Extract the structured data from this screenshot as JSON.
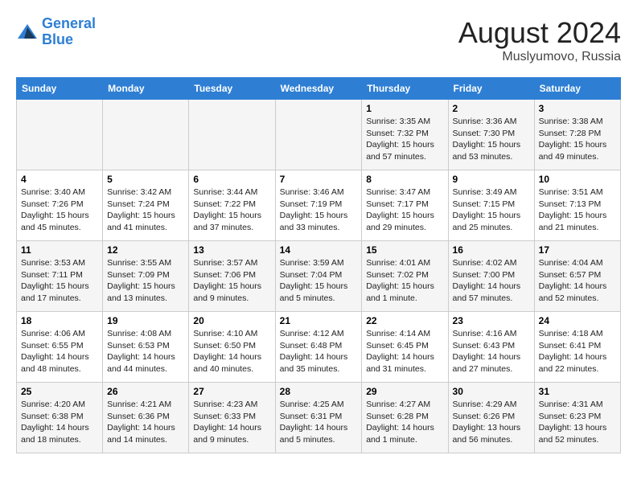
{
  "header": {
    "logo_line1": "General",
    "logo_line2": "Blue",
    "month": "August 2024",
    "location": "Muslyumovo, Russia"
  },
  "weekdays": [
    "Sunday",
    "Monday",
    "Tuesday",
    "Wednesday",
    "Thursday",
    "Friday",
    "Saturday"
  ],
  "weeks": [
    [
      {
        "day": "",
        "info": ""
      },
      {
        "day": "",
        "info": ""
      },
      {
        "day": "",
        "info": ""
      },
      {
        "day": "",
        "info": ""
      },
      {
        "day": "1",
        "info": "Sunrise: 3:35 AM\nSunset: 7:32 PM\nDaylight: 15 hours\nand 57 minutes."
      },
      {
        "day": "2",
        "info": "Sunrise: 3:36 AM\nSunset: 7:30 PM\nDaylight: 15 hours\nand 53 minutes."
      },
      {
        "day": "3",
        "info": "Sunrise: 3:38 AM\nSunset: 7:28 PM\nDaylight: 15 hours\nand 49 minutes."
      }
    ],
    [
      {
        "day": "4",
        "info": "Sunrise: 3:40 AM\nSunset: 7:26 PM\nDaylight: 15 hours\nand 45 minutes."
      },
      {
        "day": "5",
        "info": "Sunrise: 3:42 AM\nSunset: 7:24 PM\nDaylight: 15 hours\nand 41 minutes."
      },
      {
        "day": "6",
        "info": "Sunrise: 3:44 AM\nSunset: 7:22 PM\nDaylight: 15 hours\nand 37 minutes."
      },
      {
        "day": "7",
        "info": "Sunrise: 3:46 AM\nSunset: 7:19 PM\nDaylight: 15 hours\nand 33 minutes."
      },
      {
        "day": "8",
        "info": "Sunrise: 3:47 AM\nSunset: 7:17 PM\nDaylight: 15 hours\nand 29 minutes."
      },
      {
        "day": "9",
        "info": "Sunrise: 3:49 AM\nSunset: 7:15 PM\nDaylight: 15 hours\nand 25 minutes."
      },
      {
        "day": "10",
        "info": "Sunrise: 3:51 AM\nSunset: 7:13 PM\nDaylight: 15 hours\nand 21 minutes."
      }
    ],
    [
      {
        "day": "11",
        "info": "Sunrise: 3:53 AM\nSunset: 7:11 PM\nDaylight: 15 hours\nand 17 minutes."
      },
      {
        "day": "12",
        "info": "Sunrise: 3:55 AM\nSunset: 7:09 PM\nDaylight: 15 hours\nand 13 minutes."
      },
      {
        "day": "13",
        "info": "Sunrise: 3:57 AM\nSunset: 7:06 PM\nDaylight: 15 hours\nand 9 minutes."
      },
      {
        "day": "14",
        "info": "Sunrise: 3:59 AM\nSunset: 7:04 PM\nDaylight: 15 hours\nand 5 minutes."
      },
      {
        "day": "15",
        "info": "Sunrise: 4:01 AM\nSunset: 7:02 PM\nDaylight: 15 hours\nand 1 minute."
      },
      {
        "day": "16",
        "info": "Sunrise: 4:02 AM\nSunset: 7:00 PM\nDaylight: 14 hours\nand 57 minutes."
      },
      {
        "day": "17",
        "info": "Sunrise: 4:04 AM\nSunset: 6:57 PM\nDaylight: 14 hours\nand 52 minutes."
      }
    ],
    [
      {
        "day": "18",
        "info": "Sunrise: 4:06 AM\nSunset: 6:55 PM\nDaylight: 14 hours\nand 48 minutes."
      },
      {
        "day": "19",
        "info": "Sunrise: 4:08 AM\nSunset: 6:53 PM\nDaylight: 14 hours\nand 44 minutes."
      },
      {
        "day": "20",
        "info": "Sunrise: 4:10 AM\nSunset: 6:50 PM\nDaylight: 14 hours\nand 40 minutes."
      },
      {
        "day": "21",
        "info": "Sunrise: 4:12 AM\nSunset: 6:48 PM\nDaylight: 14 hours\nand 35 minutes."
      },
      {
        "day": "22",
        "info": "Sunrise: 4:14 AM\nSunset: 6:45 PM\nDaylight: 14 hours\nand 31 minutes."
      },
      {
        "day": "23",
        "info": "Sunrise: 4:16 AM\nSunset: 6:43 PM\nDaylight: 14 hours\nand 27 minutes."
      },
      {
        "day": "24",
        "info": "Sunrise: 4:18 AM\nSunset: 6:41 PM\nDaylight: 14 hours\nand 22 minutes."
      }
    ],
    [
      {
        "day": "25",
        "info": "Sunrise: 4:20 AM\nSunset: 6:38 PM\nDaylight: 14 hours\nand 18 minutes."
      },
      {
        "day": "26",
        "info": "Sunrise: 4:21 AM\nSunset: 6:36 PM\nDaylight: 14 hours\nand 14 minutes."
      },
      {
        "day": "27",
        "info": "Sunrise: 4:23 AM\nSunset: 6:33 PM\nDaylight: 14 hours\nand 9 minutes."
      },
      {
        "day": "28",
        "info": "Sunrise: 4:25 AM\nSunset: 6:31 PM\nDaylight: 14 hours\nand 5 minutes."
      },
      {
        "day": "29",
        "info": "Sunrise: 4:27 AM\nSunset: 6:28 PM\nDaylight: 14 hours\nand 1 minute."
      },
      {
        "day": "30",
        "info": "Sunrise: 4:29 AM\nSunset: 6:26 PM\nDaylight: 13 hours\nand 56 minutes."
      },
      {
        "day": "31",
        "info": "Sunrise: 4:31 AM\nSunset: 6:23 PM\nDaylight: 13 hours\nand 52 minutes."
      }
    ]
  ]
}
